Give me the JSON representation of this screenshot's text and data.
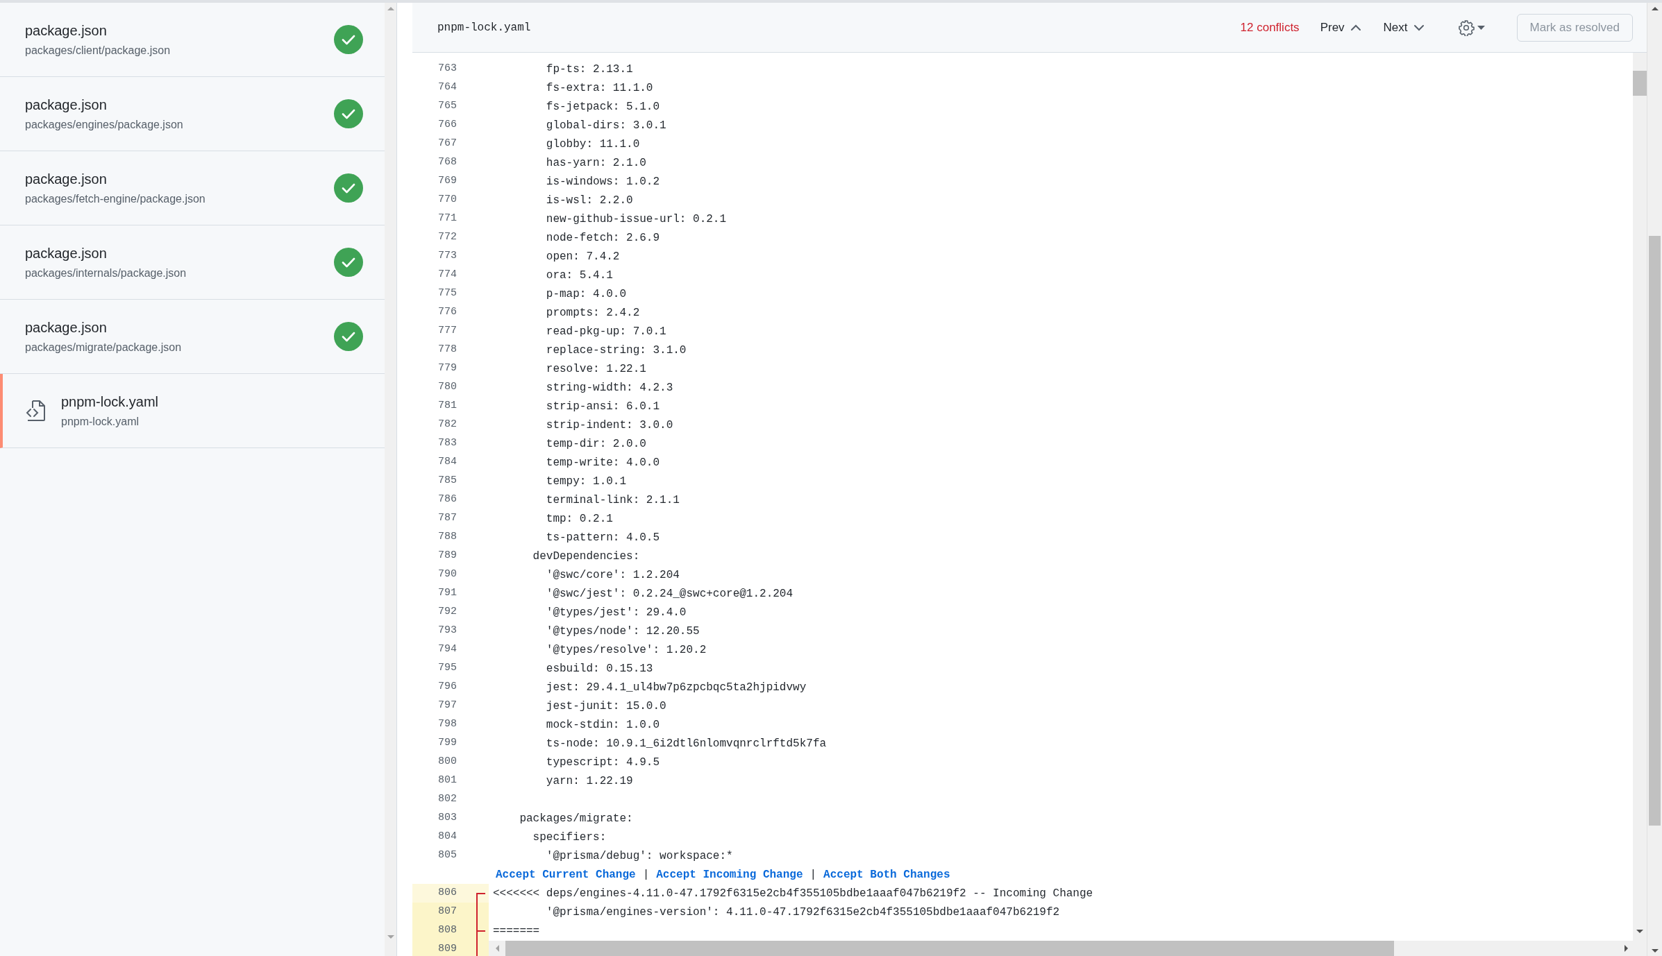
{
  "files": [
    {
      "name": "package.json",
      "path": "packages/client/package.json",
      "resolved": true,
      "selected": false
    },
    {
      "name": "package.json",
      "path": "packages/engines/package.json",
      "resolved": true,
      "selected": false
    },
    {
      "name": "package.json",
      "path": "packages/fetch-engine/package.json",
      "resolved": true,
      "selected": false
    },
    {
      "name": "package.json",
      "path": "packages/internals/package.json",
      "resolved": true,
      "selected": false
    },
    {
      "name": "package.json",
      "path": "packages/migrate/package.json",
      "resolved": true,
      "selected": false
    },
    {
      "name": "pnpm-lock.yaml",
      "path": "pnpm-lock.yaml",
      "resolved": false,
      "selected": true
    }
  ],
  "editor": {
    "filename": "pnpm-lock.yaml",
    "conflicts": "12 conflicts",
    "prev": "Prev",
    "next": "Next",
    "mark_resolved": {
      "label": "Mark as resolved",
      "disabled": true
    },
    "lines": [
      {
        "kind": "code",
        "number": "763",
        "text": "        fp-ts: 2.13.1"
      },
      {
        "kind": "code",
        "number": "764",
        "text": "        fs-extra: 11.1.0"
      },
      {
        "kind": "code",
        "number": "765",
        "text": "        fs-jetpack: 5.1.0"
      },
      {
        "kind": "code",
        "number": "766",
        "text": "        global-dirs: 3.0.1"
      },
      {
        "kind": "code",
        "number": "767",
        "text": "        globby: 11.1.0"
      },
      {
        "kind": "code",
        "number": "768",
        "text": "        has-yarn: 2.1.0"
      },
      {
        "kind": "code",
        "number": "769",
        "text": "        is-windows: 1.0.2"
      },
      {
        "kind": "code",
        "number": "770",
        "text": "        is-wsl: 2.2.0"
      },
      {
        "kind": "code",
        "number": "771",
        "text": "        new-github-issue-url: 0.2.1"
      },
      {
        "kind": "code",
        "number": "772",
        "text": "        node-fetch: 2.6.9"
      },
      {
        "kind": "code",
        "number": "773",
        "text": "        open: 7.4.2"
      },
      {
        "kind": "code",
        "number": "774",
        "text": "        ora: 5.4.1"
      },
      {
        "kind": "code",
        "number": "775",
        "text": "        p-map: 4.0.0"
      },
      {
        "kind": "code",
        "number": "776",
        "text": "        prompts: 2.4.2"
      },
      {
        "kind": "code",
        "number": "777",
        "text": "        read-pkg-up: 7.0.1"
      },
      {
        "kind": "code",
        "number": "778",
        "text": "        replace-string: 3.1.0"
      },
      {
        "kind": "code",
        "number": "779",
        "text": "        resolve: 1.22.1"
      },
      {
        "kind": "code",
        "number": "780",
        "text": "        string-width: 4.2.3"
      },
      {
        "kind": "code",
        "number": "781",
        "text": "        strip-ansi: 6.0.1"
      },
      {
        "kind": "code",
        "number": "782",
        "text": "        strip-indent: 3.0.0"
      },
      {
        "kind": "code",
        "number": "783",
        "text": "        temp-dir: 2.0.0"
      },
      {
        "kind": "code",
        "number": "784",
        "text": "        temp-write: 4.0.0"
      },
      {
        "kind": "code",
        "number": "785",
        "text": "        tempy: 1.0.1"
      },
      {
        "kind": "code",
        "number": "786",
        "text": "        terminal-link: 2.1.1"
      },
      {
        "kind": "code",
        "number": "787",
        "text": "        tmp: 0.2.1"
      },
      {
        "kind": "code",
        "number": "788",
        "text": "        ts-pattern: 4.0.5"
      },
      {
        "kind": "code",
        "number": "789",
        "text": "      devDependencies:"
      },
      {
        "kind": "code",
        "number": "790",
        "text": "        '@swc/core': 1.2.204"
      },
      {
        "kind": "code",
        "number": "791",
        "text": "        '@swc/jest': 0.2.24_@swc+core@1.2.204"
      },
      {
        "kind": "code",
        "number": "792",
        "text": "        '@types/jest': 29.4.0"
      },
      {
        "kind": "code",
        "number": "793",
        "text": "        '@types/node': 12.20.55"
      },
      {
        "kind": "code",
        "number": "794",
        "text": "        '@types/resolve': 1.20.2"
      },
      {
        "kind": "code",
        "number": "795",
        "text": "        esbuild: 0.15.13"
      },
      {
        "kind": "code",
        "number": "796",
        "text": "        jest: 29.4.1_ul4bw7p6zpcbqc5ta2hjpidvwy"
      },
      {
        "kind": "code",
        "number": "797",
        "text": "        jest-junit: 15.0.0"
      },
      {
        "kind": "code",
        "number": "798",
        "text": "        mock-stdin: 1.0.0"
      },
      {
        "kind": "code",
        "number": "799",
        "text": "        ts-node: 10.9.1_6i2dtl6nlomvqnrclrftd5k7fa"
      },
      {
        "kind": "code",
        "number": "800",
        "text": "        typescript: 4.9.5"
      },
      {
        "kind": "code",
        "number": "801",
        "text": "        yarn: 1.22.19"
      },
      {
        "kind": "code",
        "number": "802"
      },
      {
        "kind": "code",
        "number": "803",
        "text": "    packages/migrate:"
      },
      {
        "kind": "code",
        "number": "804",
        "text": "      specifiers:"
      },
      {
        "kind": "code",
        "number": "805",
        "text": "        '@prisma/debug': workspace:*"
      },
      {
        "kind": "actions",
        "actions": [
          "Accept Current Change",
          "Accept Incoming Change",
          "Accept Both Changes"
        ],
        "separator": "|"
      },
      {
        "kind": "conflict_start",
        "number": "806",
        "text": "<<<<<<< deps/engines-4.11.0-47.1792f6315e2cb4f355105bdbe1aaaf047b6219f2 -- Incoming Change"
      },
      {
        "kind": "conflict",
        "number": "807",
        "text": "        '@prisma/engines-version': 4.11.0-47.1792f6315e2cb4f355105bdbe1aaaf047b6219f2"
      },
      {
        "kind": "conflict_separator",
        "number": "808",
        "text": "======="
      },
      {
        "kind": "conflict",
        "number": "809"
      }
    ]
  }
}
